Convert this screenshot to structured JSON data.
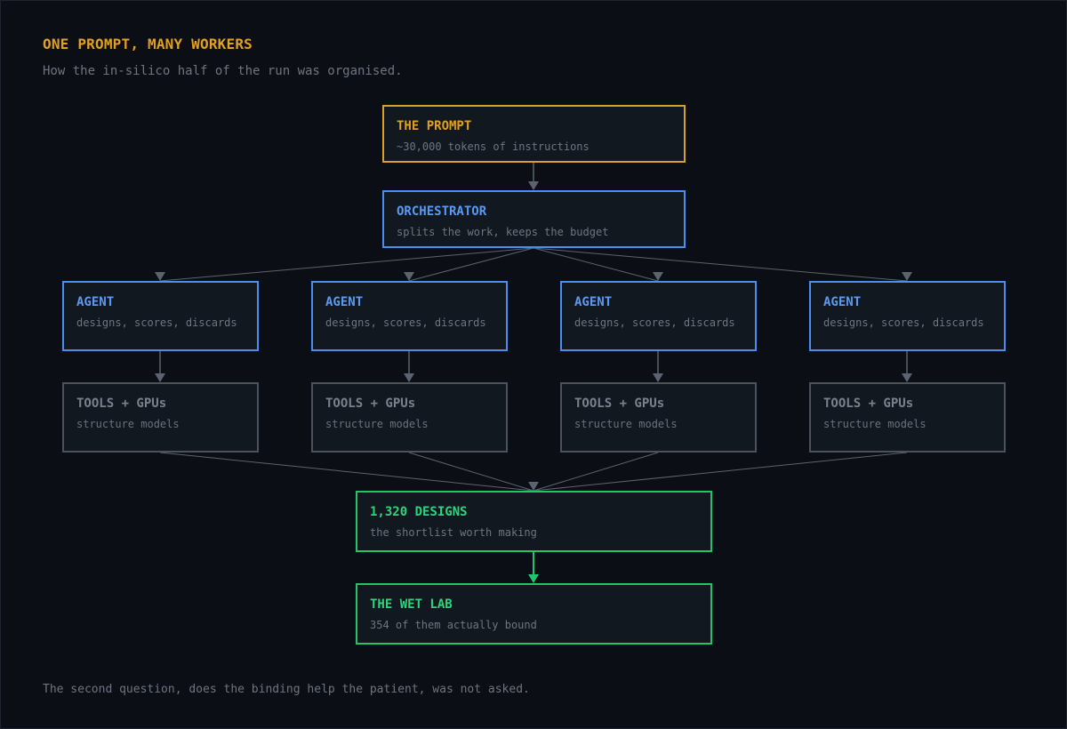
{
  "header": {
    "title": "ONE PROMPT, MANY WORKERS",
    "subtitle": "How the in-silico half of the run was organised."
  },
  "nodes": {
    "prompt": {
      "title": "THE PROMPT",
      "desc": "~30,000 tokens of instructions"
    },
    "orchestrator": {
      "title": "ORCHESTRATOR",
      "desc": "splits the work, keeps the budget"
    },
    "agents": [
      {
        "title": "AGENT",
        "desc": "designs, scores, discards"
      },
      {
        "title": "AGENT",
        "desc": "designs, scores, discards"
      },
      {
        "title": "AGENT",
        "desc": "designs, scores, discards"
      },
      {
        "title": "AGENT",
        "desc": "designs, scores, discards"
      }
    ],
    "tools": [
      {
        "title": "TOOLS + GPUs",
        "desc": "structure models"
      },
      {
        "title": "TOOLS + GPUs",
        "desc": "structure models"
      },
      {
        "title": "TOOLS + GPUs",
        "desc": "structure models"
      },
      {
        "title": "TOOLS + GPUs",
        "desc": "structure models"
      }
    ],
    "designs": {
      "title": "1,320 DESIGNS",
      "desc": "the shortlist worth making"
    },
    "wetlab": {
      "title": "THE WET LAB",
      "desc": "354 of them actually bound"
    }
  },
  "footer": {
    "note": "The second question, does the binding help the patient, was not asked."
  },
  "colors": {
    "background": "#0b0e14",
    "prompt": "#d6a22a",
    "orchestrator_agent": "#4a8ff0",
    "tools": "#4b525e",
    "output": "#22c56e",
    "connector": "#5c6370"
  }
}
